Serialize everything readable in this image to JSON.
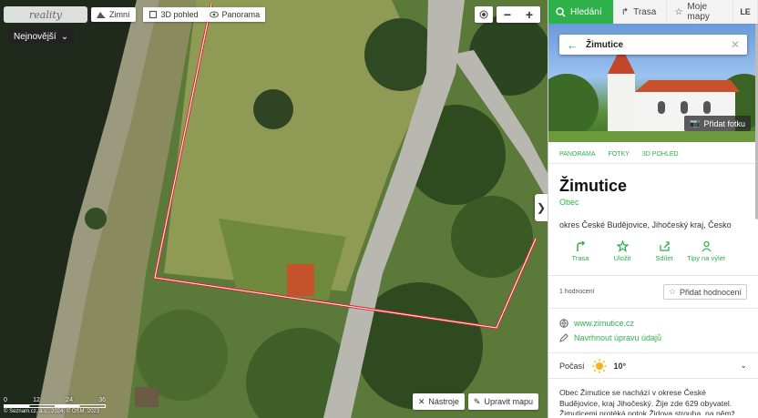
{
  "map": {
    "logo": "reality",
    "buttons": {
      "winter": "Zimní",
      "view3d": "3D pohled",
      "panorama": "Panorama"
    },
    "sort_label": "Nejnovější",
    "tools_label": "Nástroje",
    "edit_label": "Upravit mapu",
    "scale_ticks": [
      "0",
      "12",
      "24",
      "36"
    ],
    "copyright": "© Seznam.cz, a.s., 2024, © OSM, 2023"
  },
  "nav": {
    "search": "Hledání",
    "route": "Trasa",
    "my_maps": "Moje mapy",
    "user_initials": "LE"
  },
  "place": {
    "search_query": "Žimutice",
    "add_photo": "Přidat fotku",
    "tabs": [
      "PANORAMA",
      "FOTKY",
      "3D POHLED"
    ],
    "name": "Žimutice",
    "type": "Obec",
    "location": "okres České Budějovice, Jihočeský kraj, Česko",
    "actions": [
      {
        "label": "Trasa",
        "icon": "route-icon"
      },
      {
        "label": "Uložit",
        "icon": "star-icon"
      },
      {
        "label": "Sdílet",
        "icon": "share-icon"
      },
      {
        "label": "Tipy na výlet",
        "icon": "trip-icon"
      }
    ],
    "rating_count": "1 hodnocení",
    "add_rating": "Přidat hodnocení",
    "website": "www.zimutice.cz",
    "suggest_edit": "Navrhnout úpravu údajů",
    "weather_label": "Počasí",
    "weather_temp": "10°",
    "description": "Obec Žimutice se nachází v okrese České Budějovice, kraj Jihočeský. Žije zde 629 obyvatel. Žimuticemi protéká potok Židova strouha, na němž leží Žimutický rybník. V obci se nachází kostel a v místní části"
  },
  "colors": {
    "accent": "#2eb04a",
    "boundary": "#e0242b"
  }
}
